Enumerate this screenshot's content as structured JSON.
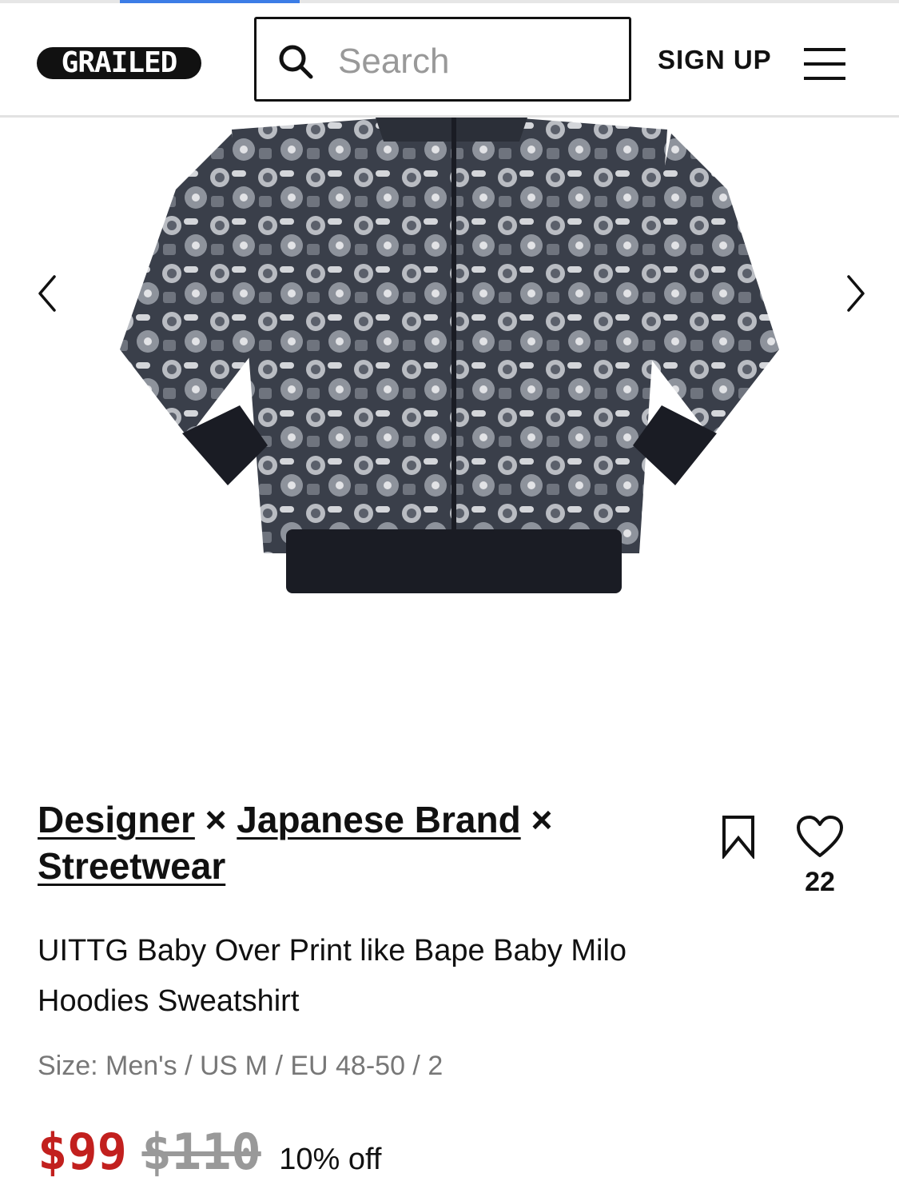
{
  "progress": {
    "fraction": 0.2
  },
  "header": {
    "logo_text": "GRAILED",
    "search": {
      "placeholder": "Search",
      "value": ""
    },
    "signup_label": "SIGN UP"
  },
  "icons": {
    "search": "search-icon",
    "menu": "menu-icon",
    "prev": "chevron-left-icon",
    "next": "chevron-right-icon",
    "bookmark": "bookmark-icon",
    "heart": "heart-icon"
  },
  "listing": {
    "designers": [
      "Designer",
      "Japanese Brand",
      "Streetwear"
    ],
    "separator": "×",
    "likes": "22",
    "title": "UITTG Baby Over Print like Bape Baby Milo Hoodies Sweatshirt",
    "size": "Size: Men's / US M / EU 48-50 / 2",
    "price_current": "$99",
    "price_original": "$110",
    "discount": "10% off"
  },
  "colors": {
    "accent_price": "#c2201e",
    "progress": "#3c7de6",
    "muted": "#777777"
  }
}
